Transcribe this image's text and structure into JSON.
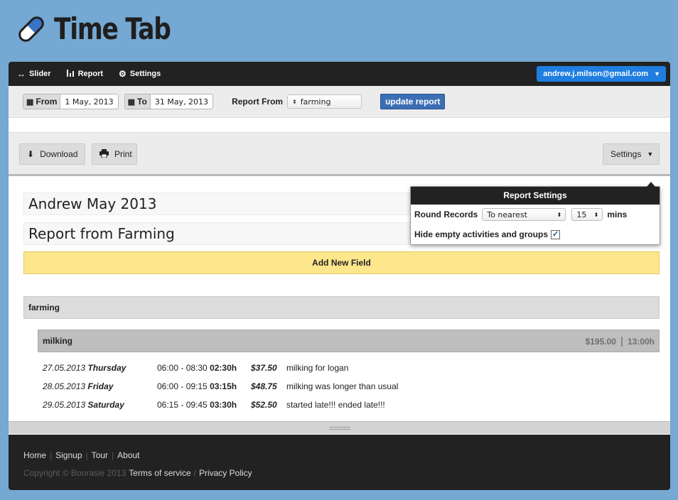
{
  "brand": {
    "name": "Time Tab",
    "logo_icon": "pill-icon"
  },
  "topnav": {
    "items": [
      {
        "label": "Slider",
        "icon": "arrows-horizontal-icon"
      },
      {
        "label": "Report",
        "icon": "bar-chart-icon"
      },
      {
        "label": "Settings",
        "icon": "gear-icon"
      }
    ],
    "account": "andrew.j.milson@gmail.com"
  },
  "filters": {
    "from_label": "From",
    "from_value": "1 May, 2013",
    "to_label": "To",
    "to_value": "31 May, 2013",
    "report_from_label": "Report From",
    "report_from_value": "farming",
    "update_button": "update report"
  },
  "toolbar": {
    "download": "Download",
    "print": "Print",
    "settings": "Settings"
  },
  "report_settings": {
    "title": "Report Settings",
    "round_records_label": "Round Records",
    "rounding_mode": "To nearest",
    "rounding_minutes": "15",
    "mins_label": "mins",
    "hide_empty_label": "Hide empty activities and groups",
    "hide_empty_checked": true
  },
  "fields": [
    "Andrew May 2013",
    "Report from Farming"
  ],
  "add_field_label": "Add New Field",
  "group": {
    "name": "farming",
    "activity": {
      "name": "milking",
      "total_amount": "$195.00",
      "total_time": "13:00h",
      "entries": [
        {
          "date": "27.05.2013",
          "day": "Thursday",
          "time_range": "06:00 - 08:30",
          "duration": "02:30h",
          "amount": "$37.50",
          "note": "milking for logan"
        },
        {
          "date": "28.05.2013",
          "day": "Friday",
          "time_range": "06:00 - 09:15",
          "duration": "03:15h",
          "amount": "$48.75",
          "note": "milking was longer than usual"
        },
        {
          "date": "29.05.2013",
          "day": "Saturday",
          "time_range": "06:15 - 09:45",
          "duration": "03:30h",
          "amount": "$52.50",
          "note": "started late!!! ended late!!!"
        }
      ]
    }
  },
  "footer": {
    "links": [
      "Home",
      "Signup",
      "Tour",
      "About"
    ],
    "copyright": "Copyright © Boorasie 2013",
    "terms": "Terms of service",
    "privacy": "Privacy Policy"
  },
  "colors": {
    "background": "#75a8d2",
    "nav": "#222222",
    "account_button": "#1f7ee0",
    "update_button": "#3b6eb4",
    "add_field": "#fde68b"
  }
}
